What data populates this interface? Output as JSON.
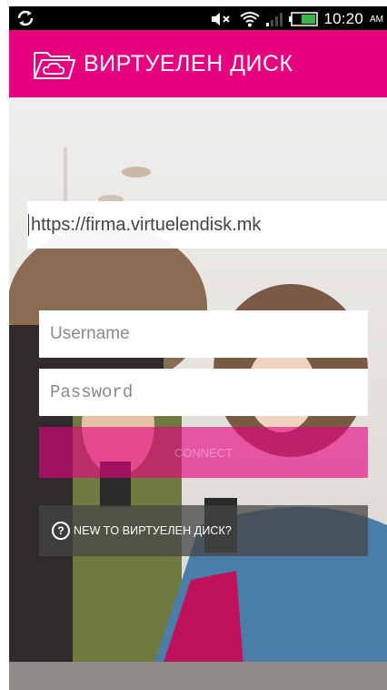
{
  "status_bar": {
    "icons": [
      "sync-icon",
      "volume-muted-icon",
      "wifi-icon",
      "signal-icon",
      "battery-icon"
    ],
    "time": "10:20",
    "ampm": "AM"
  },
  "app_bar": {
    "logo_icon": "cloud-folder-icon",
    "title": "ВИРТУЕЛЕН ДИСК",
    "background": "#e6007e"
  },
  "login": {
    "server_url": "https://firma.virtuelendisk.mk",
    "username_placeholder": "Username",
    "password_placeholder": "Password",
    "connect_label": "CONNECT",
    "help_icon": "question-circle-icon",
    "new_to_label": "NEW TO ВИРТУЕЛЕН ДИСК?"
  }
}
